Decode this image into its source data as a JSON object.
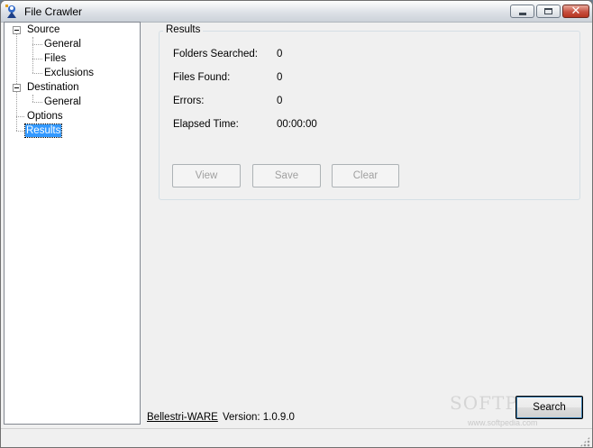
{
  "window": {
    "title": "File Crawler"
  },
  "caption_buttons": {
    "minimize": "minimize",
    "maximize": "maximize",
    "close": "close"
  },
  "tree": {
    "source": {
      "label": "Source",
      "children": [
        "General",
        "Files",
        "Exclusions"
      ]
    },
    "destination": {
      "label": "Destination",
      "children": [
        "General"
      ]
    },
    "options": "Options",
    "results": "Results",
    "selected": "Results"
  },
  "results": {
    "group_title": "Results",
    "rows": [
      {
        "label": "Folders Searched:",
        "value": "0"
      },
      {
        "label": "Files Found:",
        "value": "0"
      },
      {
        "label": "Errors:",
        "value": "0"
      },
      {
        "label": "Elapsed Time:",
        "value": "00:00:00"
      }
    ],
    "buttons": {
      "view": "View",
      "save": "Save",
      "clear": "Clear"
    }
  },
  "footer": {
    "vendor": "Bellestri-WARE",
    "version": "Version: 1.0.9.0",
    "search": "Search"
  },
  "watermark": {
    "brand": "SOFTPEDIA",
    "url": "www.softpedia.com"
  },
  "colors": {
    "selection": "#3399ff",
    "titlebar": "#dde1e7",
    "close_button": "#c75040"
  }
}
